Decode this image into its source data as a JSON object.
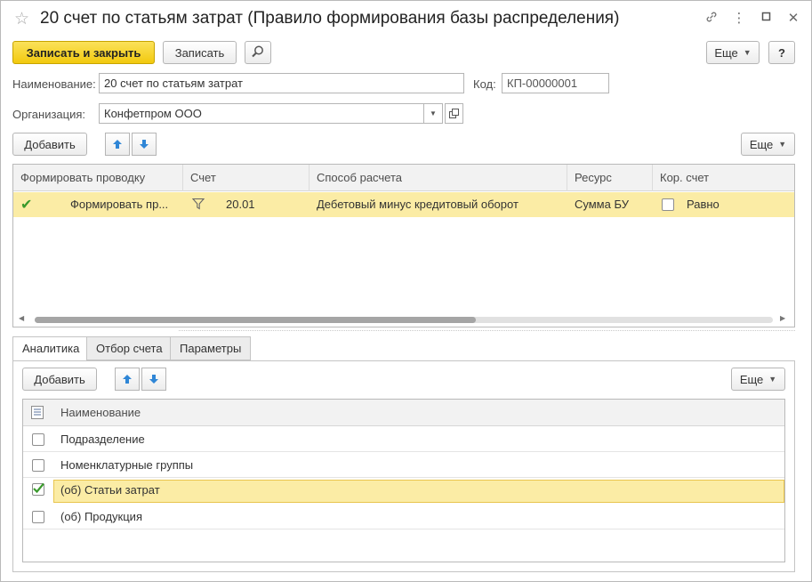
{
  "window": {
    "title": "20 счет по статьям затрат (Правило формирования базы распределения)"
  },
  "toolbar": {
    "save_close_label": "Записать и закрыть",
    "save_label": "Записать",
    "more_label": "Еще",
    "help_label": "?"
  },
  "form": {
    "name_label": "Наименование:",
    "name_value": "20 счет по статьям затрат",
    "code_label": "Код:",
    "code_value": "КП-00000001",
    "org_label": "Организация:",
    "org_value": "Конфетпром ООО"
  },
  "upper_toolbar": {
    "add_label": "Добавить",
    "more_label": "Еще"
  },
  "upper_table": {
    "columns": [
      "Формировать проводку",
      "Счет",
      "Способ расчета",
      "Ресурс",
      "Кор. счет"
    ],
    "rows": [
      {
        "post_flag": "Формировать пр...",
        "account": "20.01",
        "calc_method": "Дебетовый минус кредитовый оборот",
        "resource": "Сумма БУ",
        "corr_account": "Равно"
      }
    ]
  },
  "tabs": [
    {
      "label": "Аналитика",
      "active": true
    },
    {
      "label": "Отбор счета",
      "active": false
    },
    {
      "label": "Параметры",
      "active": false
    }
  ],
  "lower_toolbar": {
    "add_label": "Добавить",
    "more_label": "Еще"
  },
  "lower_table": {
    "header": "Наименование",
    "rows": [
      {
        "label": "Подразделение",
        "checked": false,
        "selected": false
      },
      {
        "label": "Номенклатурные группы",
        "checked": false,
        "selected": false
      },
      {
        "label": "(об) Статьи затрат",
        "checked": true,
        "selected": true
      },
      {
        "label": "(об) Продукция",
        "checked": false,
        "selected": false
      }
    ]
  },
  "colors": {
    "primary_button": "#f2c90e",
    "selected_row": "#fbeca5",
    "check_green": "#3a9a2c",
    "arrow_blue": "#2f86d6"
  }
}
